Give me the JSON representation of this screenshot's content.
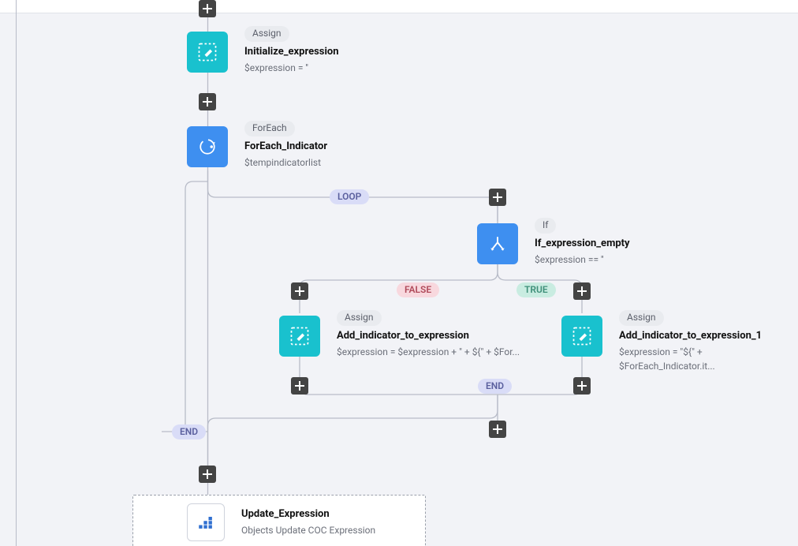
{
  "pills": {
    "loop": "LOOP",
    "end": "END",
    "false": "FALSE",
    "true": "TRUE"
  },
  "n1": {
    "tag": "Assign",
    "name": "Initialize_expression",
    "desc": "$expression = ''"
  },
  "n2": {
    "tag": "ForEach",
    "name": "ForEach_Indicator",
    "desc": "$tempindicatorlist"
  },
  "n3": {
    "tag": "If",
    "name": "If_expression_empty",
    "desc": "$expression == ''"
  },
  "n4": {
    "tag": "Assign",
    "name": "Add_indicator_to_expression",
    "desc": "$expression = $expression + \" + ${\" + $For..."
  },
  "n5": {
    "tag": "Assign",
    "name": "Add_indicator_to_expression_1",
    "desc": "$expression = \"${\" + $ForEach_Indicator.it..."
  },
  "n6": {
    "name": "Update_Expression",
    "desc": "Objects Update COC Expression"
  }
}
